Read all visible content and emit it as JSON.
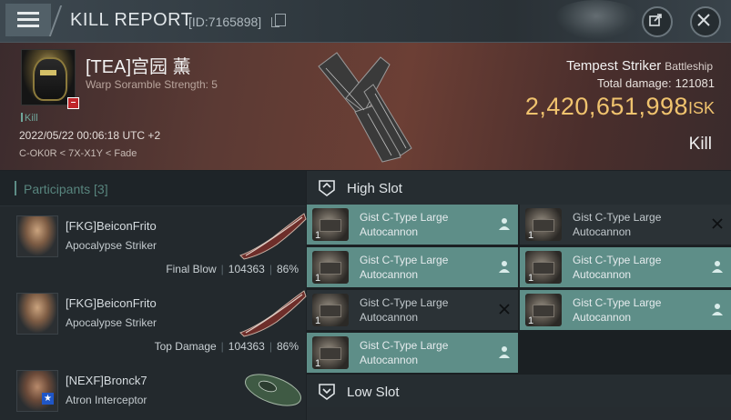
{
  "header": {
    "title": "KILL REPORT",
    "id_text": "[ID:7165898]"
  },
  "victim": {
    "name": "[TEA]宫园 薰",
    "subtitle": "Warp Soramble Strength: 5",
    "kill_tag": "Kill",
    "datetime": "2022/05/22 00:06:18 UTC +2",
    "location": "C-OK0R < 7X-X1Y < Fade",
    "ship_name": "Tempest Striker",
    "ship_class": "Battleship",
    "total_damage_label": "Total damage:",
    "total_damage": "121081",
    "isk_value": "2,420,651,998",
    "isk_unit": "ISK",
    "result": "Kill"
  },
  "participants": {
    "title": "Participants",
    "count": "[3]",
    "items": [
      {
        "name": "[FKG]BeiconFrito",
        "ship": "Apocalypse Striker",
        "role": "Final Blow",
        "damage": "104363",
        "percent": "86%"
      },
      {
        "name": "[FKG]BeiconFrito",
        "ship": "Apocalypse Striker",
        "role": "Top Damage",
        "damage": "104363",
        "percent": "86%"
      },
      {
        "name": "[NEXF]Bronck7",
        "ship": "Atron Interceptor"
      }
    ]
  },
  "slots": {
    "high": {
      "label": "High Slot",
      "modules": [
        {
          "name": "Gist C-Type Large Autocannon",
          "qty": "1",
          "status": "active"
        },
        {
          "name": "Gist C-Type Large Autocannon",
          "qty": "1",
          "status": "destroyed"
        },
        {
          "name": "Gist C-Type Large Autocannon",
          "qty": "1",
          "status": "active"
        },
        {
          "name": "Gist C-Type Large Autocannon",
          "qty": "1",
          "status": "active"
        },
        {
          "name": "Gist C-Type Large Autocannon",
          "qty": "1",
          "status": "destroyed"
        },
        {
          "name": "Gist C-Type Large Autocannon",
          "qty": "1",
          "status": "active"
        },
        {
          "name": "Gist C-Type Large Autocannon",
          "qty": "1",
          "status": "active"
        }
      ]
    },
    "low": {
      "label": "Low Slot"
    }
  },
  "colors": {
    "accent_teal": "#5e8e88",
    "isk_gold": "#f0c36e",
    "hero_red": "#6c3f35"
  }
}
